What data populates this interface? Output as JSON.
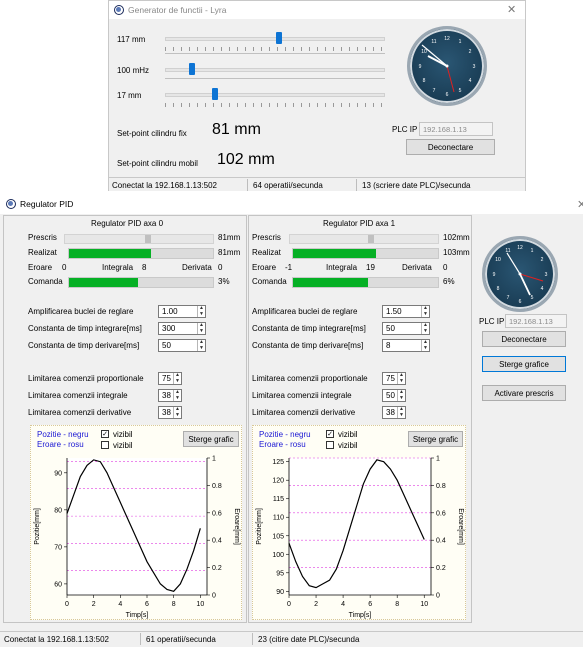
{
  "gen": {
    "title": "Generator de functii - Lyra",
    "sliders": [
      {
        "label": "117 mm",
        "level": 0.52
      },
      {
        "label": "100 mHz",
        "level": 0.11
      },
      {
        "label": "17 mm",
        "level": 0.22
      }
    ],
    "setpoint_fix_label": "Set-point cilindru fix",
    "setpoint_fix_value": "81 mm",
    "setpoint_mobil_label": "Set-point cilindru mobil",
    "setpoint_mobil_value": "102 mm",
    "plc_label": "PLC IP",
    "plc_ip": "192.168.1.13",
    "disconnect": "Deconectare",
    "status": [
      "Conectat la 192.168.1.13:502",
      "64 operatii/secunda",
      "13 (scriere date PLC)/secunda"
    ]
  },
  "pid": {
    "title": "Regulator PID",
    "axes": [
      {
        "header": "Regulator PID axa 0",
        "prescris_label": "Prescris",
        "prescris_value": "81mm",
        "prescris_level": 0.57,
        "realizat_label": "Realizat",
        "realizat_value": "81mm",
        "realizat_level": 0.57,
        "eroare_label": "Eroare",
        "eroare_value": "0",
        "integrala_label": "Integrala",
        "integrala_value": "8",
        "derivata_label": "Derivata",
        "derivata_value": "0",
        "comanda_label": "Comanda",
        "comanda_value": "3%",
        "comanda_level": 0.48,
        "params": [
          {
            "label": "Amplificarea buclei de reglare",
            "value": "1.00"
          },
          {
            "label": "Constanta de timp integrare[ms]",
            "value": "300"
          },
          {
            "label": "Constanta de timp derivare[ms]",
            "value": "50"
          }
        ],
        "limits": [
          {
            "label": "Limitarea comenzii proportionale",
            "value": "75"
          },
          {
            "label": "Limitarea comenzii integrale",
            "value": "38"
          },
          {
            "label": "Limitarea comenzii derivative",
            "value": "38"
          }
        ],
        "chart": {
          "legend_pos": "Pozitie - negru",
          "legend_err": "Eroare - rosu",
          "vizibil1": "vizibil",
          "vizibil2": "vizibil",
          "clear": "Sterge grafic",
          "ylabel_left": "Pozitie[mm]",
          "ylabel_right": "Eroare[mm]",
          "xlabel": "Timp[s]"
        }
      },
      {
        "header": "Regulator PID axa 1",
        "prescris_label": "Prescris",
        "prescris_value": "102mm",
        "prescris_level": 0.56,
        "realizat_label": "Realizat",
        "realizat_value": "103mm",
        "realizat_level": 0.57,
        "eroare_label": "Eroare",
        "eroare_value": "-1",
        "integrala_label": "Integrala",
        "integrala_value": "19",
        "derivata_label": "Derivata",
        "derivata_value": "0",
        "comanda_label": "Comanda",
        "comanda_value": "6%",
        "comanda_level": 0.52,
        "params": [
          {
            "label": "Amplificarea buclei de reglare",
            "value": "1.50"
          },
          {
            "label": "Constanta de timp integrare[ms]",
            "value": "50"
          },
          {
            "label": "Constanta de timp derivare[ms]",
            "value": "8"
          }
        ],
        "limits": [
          {
            "label": "Limitarea comenzii proportionale",
            "value": "75"
          },
          {
            "label": "Limitarea comenzii integrale",
            "value": "50"
          },
          {
            "label": "Limitarea comenzii derivative",
            "value": "38"
          }
        ],
        "chart": {
          "legend_pos": "Pozitie - negru",
          "legend_err": "Eroare - rosu",
          "vizibil1": "vizibil",
          "vizibil2": "vizibil",
          "clear": "Sterge grafic",
          "ylabel_left": "Pozitie[mm]",
          "ylabel_right": "Eroare[mm]",
          "xlabel": "Timp[s]"
        }
      }
    ],
    "plc_label": "PLC IP",
    "plc_ip": "192.168.1.13",
    "disconnect": "Deconectare",
    "clear_charts": "Sterge grafice",
    "activate": "Activare prescris",
    "status": [
      "Conectat la 192.168.1.13:502",
      "61 operatii/secunda",
      "23 (citire date PLC)/secunda"
    ]
  },
  "chart_data": [
    {
      "type": "line",
      "xlim": [
        0,
        10.5
      ],
      "ylim": [
        57,
        94
      ],
      "y2lim": [
        0,
        1
      ],
      "xticks": [
        0,
        2,
        4,
        6,
        8,
        10
      ],
      "yticks": [
        60,
        70,
        80,
        90
      ],
      "y2ticks": [
        0,
        0.2,
        0.4,
        0.6,
        0.8,
        1
      ],
      "xlabel": "Timp[s]",
      "ylabel": "Pozitie[mm]",
      "y2label": "Eroare[mm]",
      "gridlines_y": [
        63.6,
        70.9,
        78.3,
        85.7,
        93
      ],
      "series": [
        {
          "x": [
            0,
            0.5,
            1,
            1.5,
            2,
            2.5,
            3,
            3.5,
            4,
            4.5,
            5,
            5.5,
            6,
            6.5,
            7,
            7.5,
            8,
            8.5,
            9,
            9.5,
            10
          ],
          "values": [
            79,
            84,
            89,
            92,
            93.5,
            93,
            90,
            86,
            82,
            78,
            74,
            70,
            66,
            63,
            60,
            58.5,
            58,
            60,
            64,
            69,
            75
          ]
        }
      ]
    },
    {
      "type": "line",
      "xlim": [
        0,
        10.5
      ],
      "ylim": [
        89,
        126
      ],
      "y2lim": [
        0,
        1
      ],
      "xticks": [
        0,
        2,
        4,
        6,
        8,
        10
      ],
      "yticks": [
        90,
        95,
        100,
        105,
        110,
        115,
        120,
        125
      ],
      "y2ticks": [
        0,
        0.2,
        0.4,
        0.6,
        0.8,
        1
      ],
      "xlabel": "Timp[s]",
      "ylabel": "Pozitie[mm]",
      "y2label": "Eroare[mm]",
      "gridlines_y": [
        96.4,
        103.8,
        111.2,
        118.6,
        126
      ],
      "series": [
        {
          "x": [
            0,
            0.5,
            1,
            1.5,
            2,
            2.5,
            3,
            3.5,
            4,
            4.5,
            5,
            5.5,
            6,
            6.5,
            7,
            7.5,
            8,
            8.5,
            9,
            9.5,
            10
          ],
          "values": [
            103,
            98,
            94,
            91.5,
            91,
            92,
            93,
            96,
            101,
            107,
            113,
            119,
            123,
            125.5,
            125,
            123,
            120,
            116,
            112,
            108,
            104
          ]
        }
      ]
    }
  ]
}
